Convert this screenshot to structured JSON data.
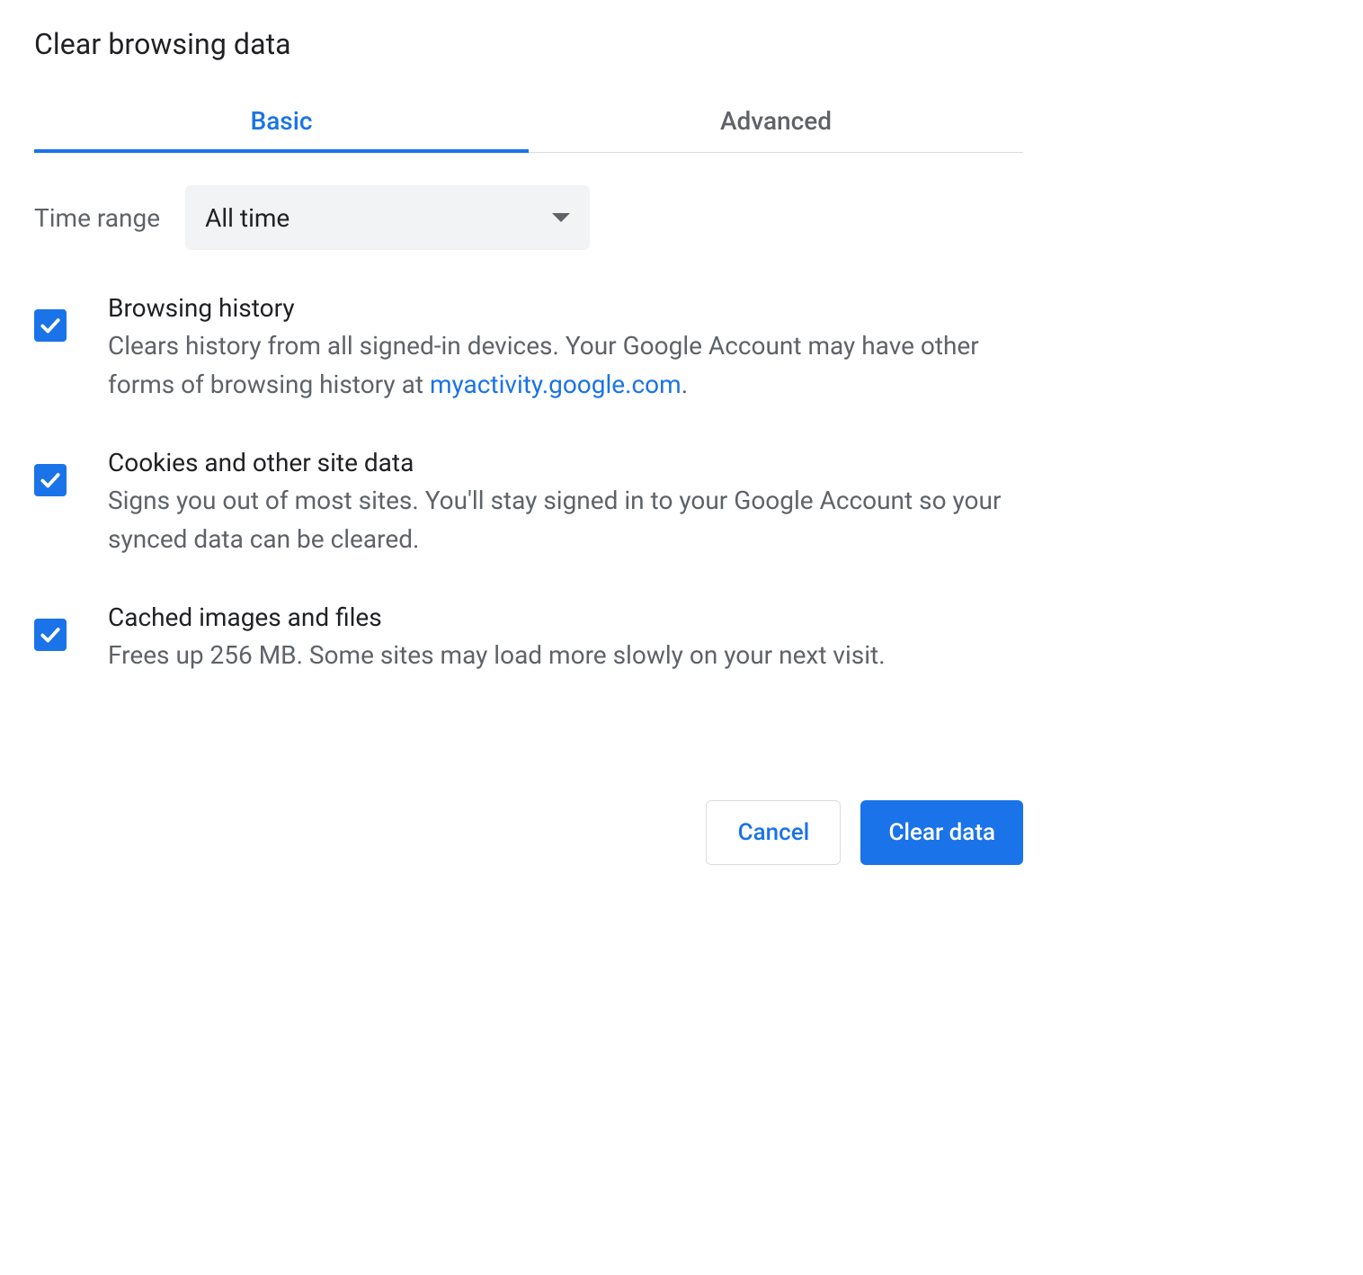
{
  "dialog": {
    "title": "Clear browsing data"
  },
  "tabs": {
    "basic": "Basic",
    "advanced": "Advanced"
  },
  "time_range": {
    "label": "Time range",
    "value": "All time"
  },
  "options": {
    "browsing_history": {
      "title": "Browsing history",
      "desc_prefix": "Clears history from all signed-in devices. Your Google Account may have other forms of browsing history at ",
      "link_text": "myactivity.google.com",
      "desc_suffix": "."
    },
    "cookies": {
      "title": "Cookies and other site data",
      "desc": "Signs you out of most sites. You'll stay signed in to your Google Account so your synced data can be cleared."
    },
    "cache": {
      "title": "Cached images and files",
      "desc": "Frees up 256 MB. Some sites may load more slowly on your next visit."
    }
  },
  "buttons": {
    "cancel": "Cancel",
    "clear": "Clear data"
  }
}
